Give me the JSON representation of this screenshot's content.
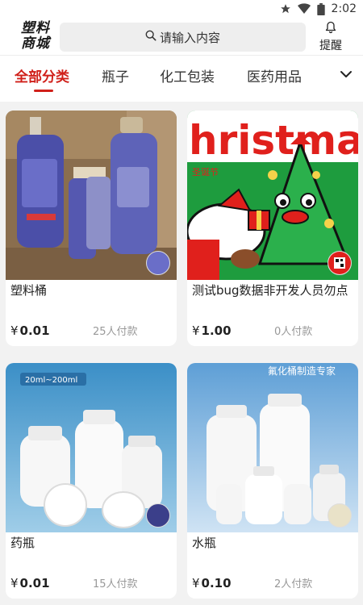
{
  "status_bar": {
    "time": "2:02"
  },
  "header": {
    "logo_line1": "塑料",
    "logo_line2": "商城",
    "search_placeholder": "请输入内容",
    "remind_label": "提醒"
  },
  "tabs": {
    "items": [
      "全部分类",
      "瓶子",
      "化工包装",
      "医药用品"
    ],
    "active_index": 0
  },
  "products": [
    {
      "title": "塑料桶",
      "currency": "¥",
      "price": "0.01",
      "paid": "25人付款"
    },
    {
      "title": "测试bug数据非开发人员勿点",
      "currency": "¥",
      "price": "1.00",
      "paid": "0人付款"
    },
    {
      "title": "药瓶",
      "currency": "¥",
      "price": "0.01",
      "paid": "15人付款"
    },
    {
      "title": "水瓶",
      "currency": "¥",
      "price": "0.10",
      "paid": "2人付款"
    }
  ],
  "image_text": {
    "christmas_banner": "hristma",
    "christmas_sub": "圣诞节",
    "bottle_range": "20ml~200ml",
    "fluoride_title": "氟化桶制造专家"
  },
  "colors": {
    "accent": "#d0201a",
    "christmas_green": "#1e9c3e",
    "christmas_red": "#e0201c"
  }
}
